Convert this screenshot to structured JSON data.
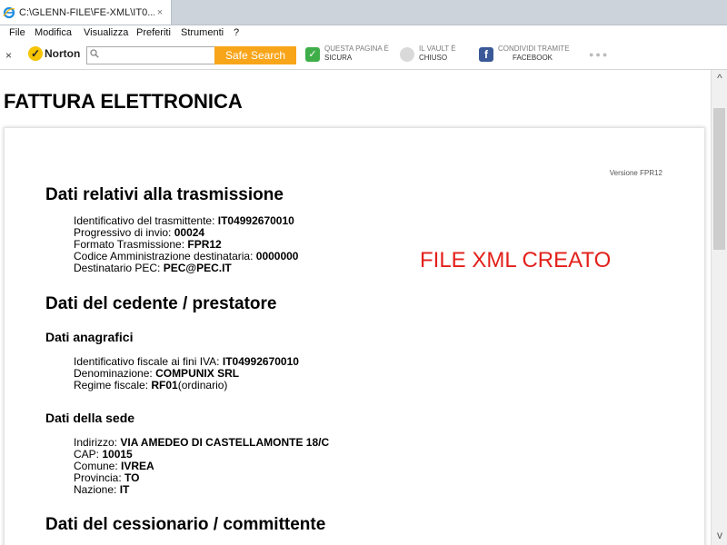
{
  "tab": {
    "title": "C:\\GLENN-FILE\\FE-XML\\IT0...",
    "close": "×",
    "icon": "ie-icon"
  },
  "menu": [
    "File",
    "Modifica",
    "Visualizza",
    "Preferiti",
    "Strumenti",
    "?"
  ],
  "norton": {
    "close": "×",
    "logo": "Norton",
    "search_value": "",
    "safe_search": "Safe Search",
    "features": [
      {
        "line1": "QUESTA PAGINA È",
        "line2": "SICURA",
        "icon": "check-shield-icon",
        "color": "#3fae49"
      },
      {
        "line1": "IL VAULT È",
        "line2": "CHIUSO",
        "icon": "vault-icon",
        "color": "#bdbdbd"
      },
      {
        "line1": "CONDIVIDI TRAMITE",
        "line2": "FACEBOOK",
        "icon": "facebook-icon",
        "color": "#3b5998"
      }
    ],
    "dots": "●●●"
  },
  "page": {
    "title": "FATTURA ELETTRONICA",
    "versione": "Versione FPR12",
    "banner": "FILE XML CREATO",
    "trasmissione": {
      "heading": "Dati relativi alla trasmissione",
      "rows": [
        {
          "label": "Identificativo del trasmittente: ",
          "value": "IT04992670010"
        },
        {
          "label": "Progressivo di invio: ",
          "value": "00024"
        },
        {
          "label": "Formato Trasmissione: ",
          "value": "FPR12"
        },
        {
          "label": "Codice Amministrazione destinataria: ",
          "value": "0000000"
        },
        {
          "label": "Destinatario PEC: ",
          "value": "PEC@PEC.IT"
        }
      ]
    },
    "cedente": {
      "heading": "Dati del cedente / prestatore",
      "anagrafici": {
        "heading": "Dati anagrafici",
        "rows": [
          {
            "label": "Identificativo fiscale ai fini IVA: ",
            "value": "IT04992670010",
            "suffix": ""
          },
          {
            "label": "Denominazione: ",
            "value": "COMPUNIX SRL",
            "suffix": ""
          },
          {
            "label": "Regime fiscale: ",
            "value": "RF01",
            "suffix": "(ordinario)"
          }
        ]
      },
      "sede": {
        "heading": "Dati della sede",
        "rows": [
          {
            "label": "Indirizzo: ",
            "value": "VIA AMEDEO DI CASTELLAMONTE 18/C"
          },
          {
            "label": "CAP: ",
            "value": "10015"
          },
          {
            "label": "Comune: ",
            "value": "IVREA"
          },
          {
            "label": "Provincia: ",
            "value": "TO"
          },
          {
            "label": "Nazione: ",
            "value": "IT"
          }
        ]
      }
    },
    "cessionario": {
      "heading": "Dati del cessionario / committente"
    }
  },
  "scrollbar": {
    "up": "^",
    "down": "v"
  }
}
